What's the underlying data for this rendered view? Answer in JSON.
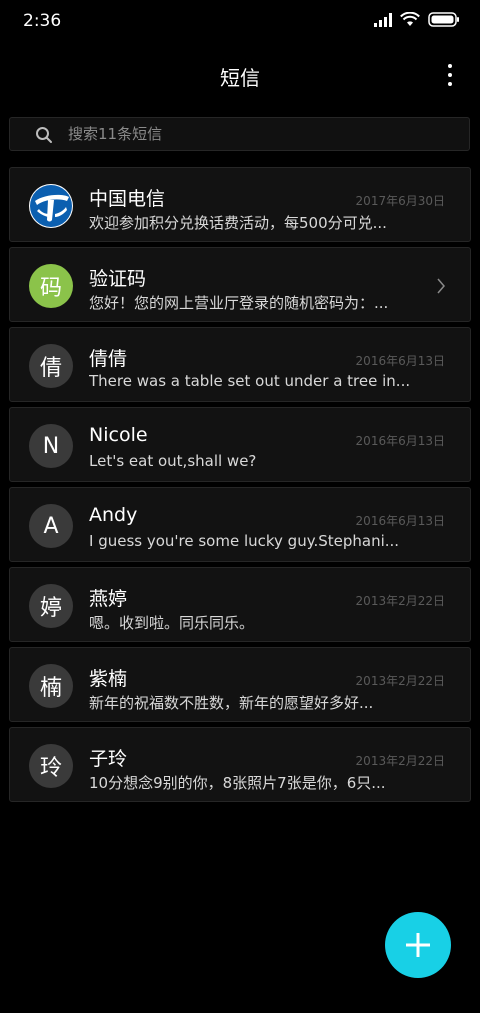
{
  "status_bar": {
    "time": "2:36"
  },
  "header": {
    "title": "短信"
  },
  "search": {
    "placeholder": "搜索11条短信"
  },
  "conversations": [
    {
      "avatar_text": "",
      "avatar_icon": "china-telecom-logo-icon",
      "name": "中国电信",
      "date": "2017年6月30日",
      "preview": "欢迎参加积分兑换话费活动，每500分可兑..."
    },
    {
      "avatar_text": "码",
      "name": "验证码",
      "date": "",
      "preview": "您好！您的网上营业厅登录的随机密码为：..."
    },
    {
      "avatar_text": "倩",
      "name": "倩倩",
      "date": "2016年6月13日",
      "preview": "There was a table set out under a tree in..."
    },
    {
      "avatar_text": "N",
      "name": "Nicole",
      "date": "2016年6月13日",
      "preview": "Let's eat out,shall we?"
    },
    {
      "avatar_text": "A",
      "name": "Andy",
      "date": "2016年6月13日",
      "preview": "I guess you're some lucky guy.Stephani..."
    },
    {
      "avatar_text": "婷",
      "name": "燕婷",
      "date": "2013年2月22日",
      "preview": "嗯。收到啦。同乐同乐。"
    },
    {
      "avatar_text": "楠",
      "name": "紫楠",
      "date": "2013年2月22日",
      "preview": "新年的祝福数不胜数，新年的愿望好多好..."
    },
    {
      "avatar_text": "玲",
      "name": "子玲",
      "date": "2013年2月22日",
      "preview": "10分想念9别的你，8张照片7张是你，6只..."
    }
  ],
  "colors": {
    "background": "#000000",
    "card": "#121212",
    "accent_fab": "#18d0e6",
    "avatar_default": "#3a3a3a",
    "avatar_green": "#8bc34a",
    "telecom_blue": "#0b5fb0"
  }
}
